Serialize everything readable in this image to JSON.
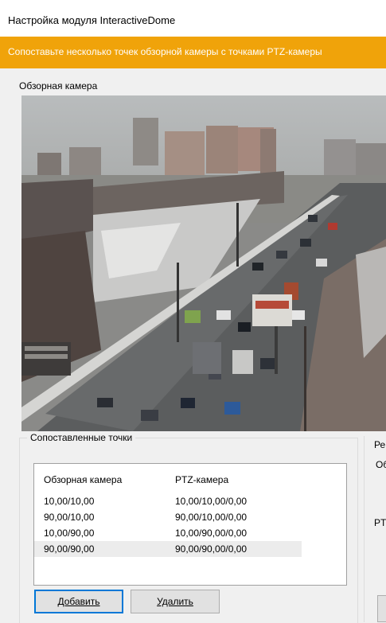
{
  "window": {
    "title": "Настройка модуля InteractiveDome"
  },
  "banner": {
    "text": "Сопоставьте несколько точек обзорной камеры с точками PTZ-камеры",
    "color": "#f0a30a"
  },
  "overview_section": {
    "label": "Обзорная камера"
  },
  "matched_points": {
    "legend": "Сопоставленные точки",
    "columns": [
      "Обзорная камера",
      "PTZ-камера"
    ],
    "rows": [
      {
        "overview": "10,00/10,00",
        "ptz": "10,00/10,00/0,00"
      },
      {
        "overview": "90,00/10,00",
        "ptz": "90,00/10,00/0,00"
      },
      {
        "overview": "10,00/90,00",
        "ptz": "10,00/90,00/0,00"
      },
      {
        "overview": "90,00/90,00",
        "ptz": "90,00/90,00/0,00"
      }
    ],
    "selected_row": 3
  },
  "buttons": {
    "add": "Добавить",
    "delete": "Удалить"
  },
  "right_panel": {
    "frag1": "Ре",
    "frag2": "Об",
    "frag3": "PT"
  },
  "accent_color": "#0078d7"
}
